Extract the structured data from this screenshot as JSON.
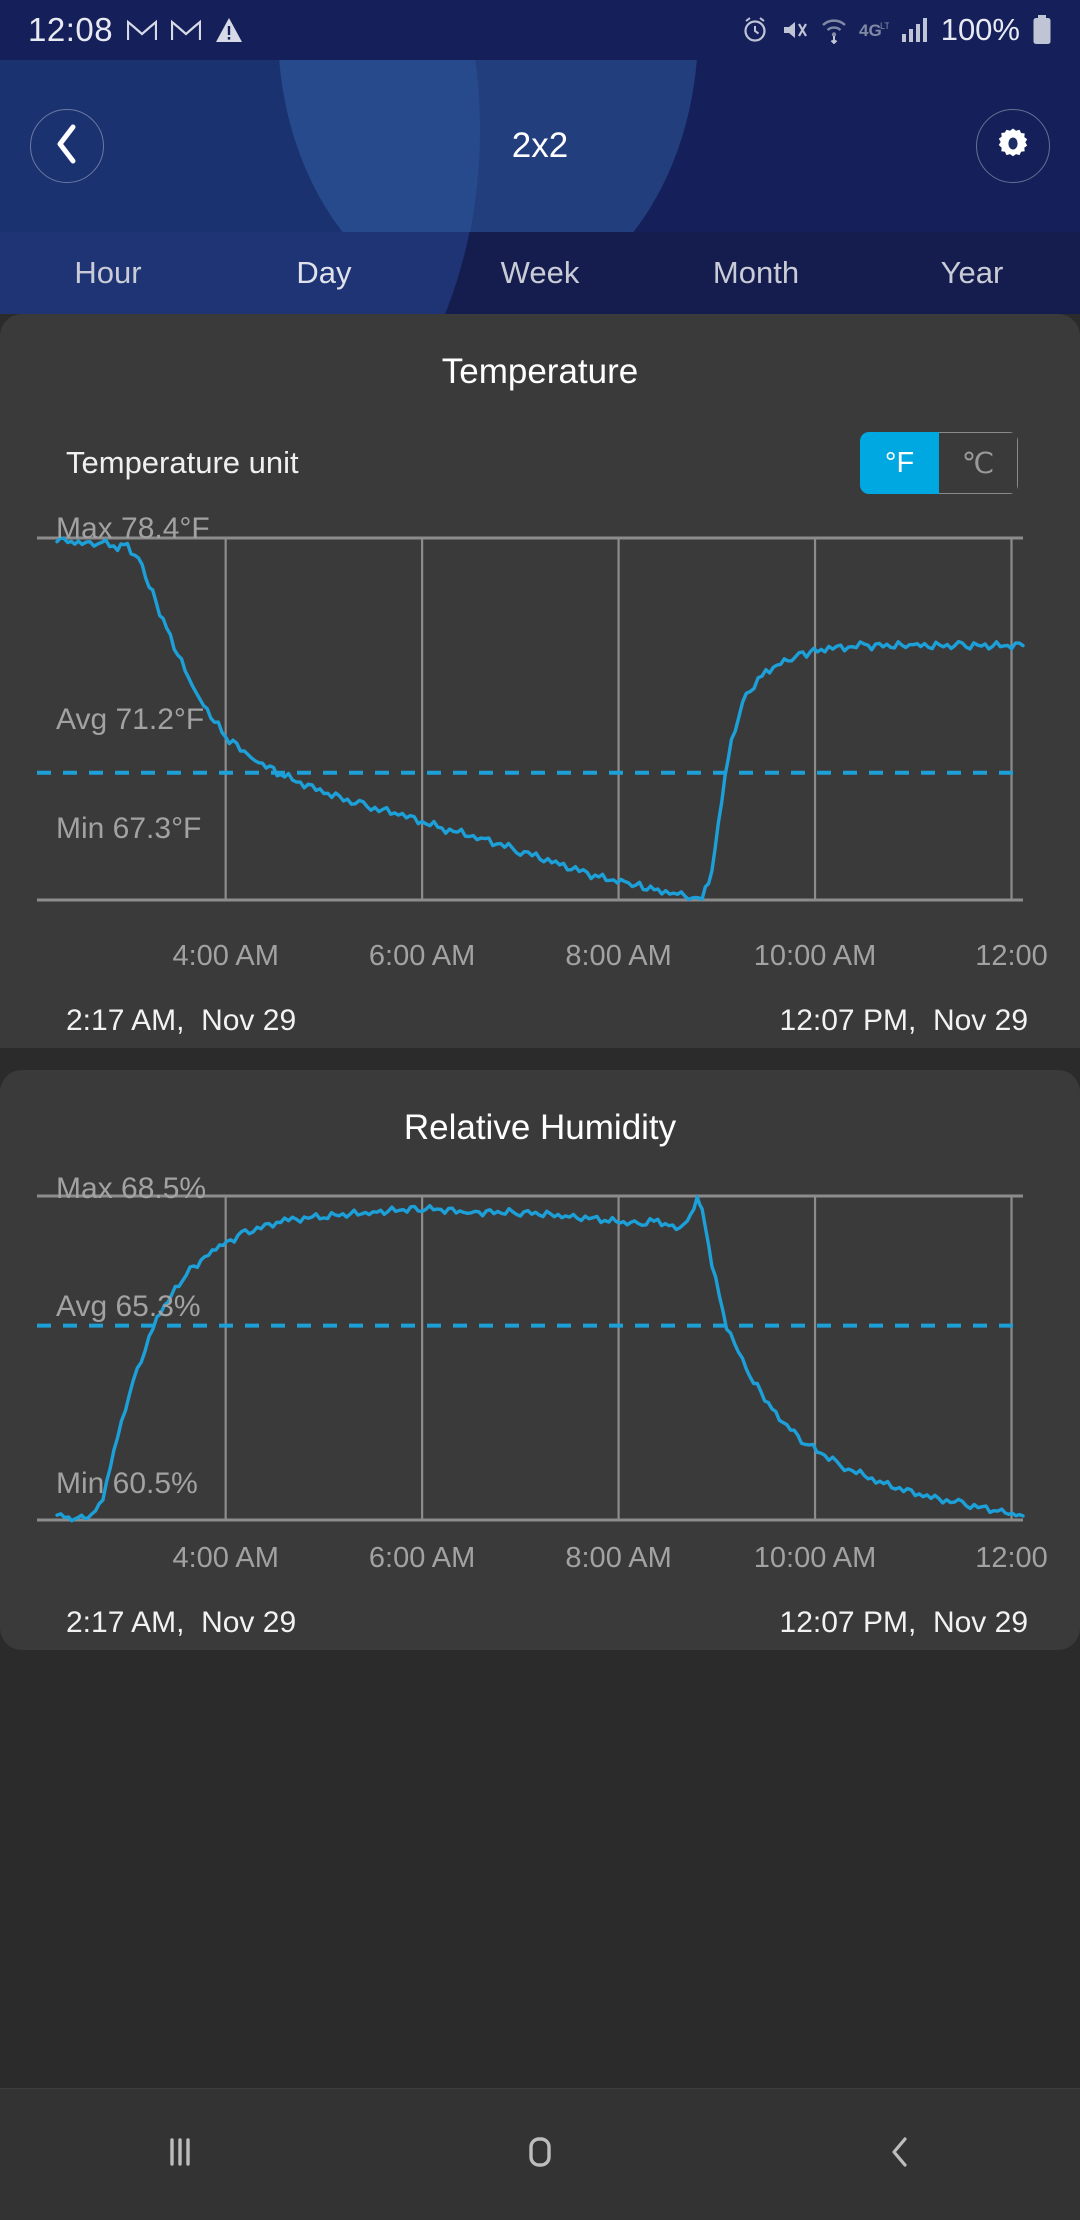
{
  "status_bar": {
    "time": "12:08",
    "battery_text": "100%",
    "icons": [
      "gmail-icon",
      "gmail-icon",
      "warning-triangle-icon",
      "alarm-icon",
      "mute-icon",
      "wifi-icon",
      "4g-icon",
      "signal-icon",
      "battery-icon"
    ]
  },
  "header": {
    "title": "2x2",
    "back_icon": "chevron-left-icon",
    "settings_icon": "gear-icon"
  },
  "tabs": [
    {
      "label": "Hour",
      "active": false
    },
    {
      "label": "Day",
      "active": true
    },
    {
      "label": "Week",
      "active": false
    },
    {
      "label": "Month",
      "active": false
    },
    {
      "label": "Year",
      "active": false
    }
  ],
  "temperature_card": {
    "title": "Temperature",
    "unit_label": "Temperature unit",
    "unit_options": [
      {
        "label": "°F",
        "selected": true
      },
      {
        "label": "℃",
        "selected": false
      }
    ],
    "max_label": "Max 78.4°F",
    "avg_label": "Avg 71.2°F",
    "min_label": "Min 67.3°F",
    "range_start": "2:17 AM,  Nov 29",
    "range_end": "12:07 PM,  Nov 29"
  },
  "humidity_card": {
    "title": "Relative Humidity",
    "max_label": "Max 68.5%",
    "avg_label": "Avg 65.3%",
    "min_label": "Min 60.5%",
    "range_start": "2:17 AM,  Nov 29",
    "range_end": "12:07 PM,  Nov 29"
  },
  "nav_bar": {
    "recents_icon": "recents-icon",
    "home_icon": "home-icon",
    "back_icon": "back-chevron-icon"
  },
  "colors": {
    "accent": "#00a8e1",
    "line": "#1d9fd8",
    "header_bg": "#15205a",
    "card_bg": "#3a3a3a",
    "page_bg": "#2b2b2b",
    "grid": "#8c8c8c",
    "muted_text": "#a2a2a2"
  },
  "chart_data": [
    {
      "type": "line",
      "title": "Temperature",
      "xlabel": "",
      "ylabel": "°F",
      "unit": "°F",
      "ylim": [
        67.3,
        78.4
      ],
      "xlim": [
        "2:17 AM",
        "12:07 PM"
      ],
      "grid": true,
      "legend": "none",
      "max": 78.4,
      "avg": 71.2,
      "min": 67.3,
      "avg_line": 71.2,
      "tick_labels": [
        "4:00 AM",
        "6:00 AM",
        "8:00 AM",
        "10:00 AM",
        "12:00"
      ],
      "x_hours": [
        2.283,
        2.5,
        2.7,
        2.9,
        3.0,
        3.15,
        3.4,
        3.7,
        4.0,
        4.3,
        4.6,
        5.0,
        5.4,
        5.8,
        6.2,
        6.6,
        7.0,
        7.4,
        7.8,
        8.1,
        8.4,
        8.6,
        8.75,
        8.85,
        8.95,
        9.05,
        9.15,
        9.3,
        9.5,
        9.8,
        10.1,
        10.5,
        11.0,
        11.5,
        12.117
      ],
      "values": [
        78.4,
        78.2,
        78.3,
        78.1,
        78.2,
        77.5,
        75.6,
        73.6,
        72.3,
        71.6,
        71.1,
        70.6,
        70.2,
        69.9,
        69.5,
        69.2,
        68.8,
        68.4,
        68.0,
        67.8,
        67.6,
        67.5,
        67.4,
        67.3,
        68.2,
        70.4,
        72.2,
        73.6,
        74.3,
        74.8,
        75.0,
        75.1,
        75.1,
        75.1,
        75.1
      ]
    },
    {
      "type": "line",
      "title": "Relative Humidity",
      "xlabel": "",
      "ylabel": "%",
      "unit": "%",
      "ylim": [
        60.5,
        68.5
      ],
      "xlim": [
        "2:17 AM",
        "12:07 PM"
      ],
      "grid": true,
      "legend": "none",
      "max": 68.5,
      "avg": 65.3,
      "min": 60.5,
      "avg_line": 65.3,
      "tick_labels": [
        "4:00 AM",
        "6:00 AM",
        "8:00 AM",
        "10:00 AM",
        "12:00"
      ],
      "x_hours": [
        2.283,
        2.4,
        2.5,
        2.6,
        2.75,
        2.9,
        3.1,
        3.3,
        3.6,
        3.9,
        4.2,
        4.6,
        5.0,
        5.5,
        6.0,
        6.5,
        7.0,
        7.5,
        7.9,
        8.2,
        8.4,
        8.55,
        8.7,
        8.8,
        8.85,
        8.95,
        9.1,
        9.3,
        9.6,
        9.9,
        10.3,
        10.7,
        11.1,
        11.5,
        11.9,
        12.117
      ],
      "values": [
        60.7,
        60.5,
        60.6,
        60.5,
        61.0,
        62.6,
        64.2,
        65.5,
        66.6,
        67.2,
        67.6,
        67.9,
        68.0,
        68.1,
        68.2,
        68.1,
        68.1,
        68.0,
        67.9,
        67.8,
        67.9,
        67.7,
        67.8,
        68.5,
        68.2,
        66.8,
        65.3,
        64.2,
        63.1,
        62.4,
        61.8,
        61.4,
        61.1,
        60.9,
        60.7,
        60.6
      ]
    }
  ]
}
